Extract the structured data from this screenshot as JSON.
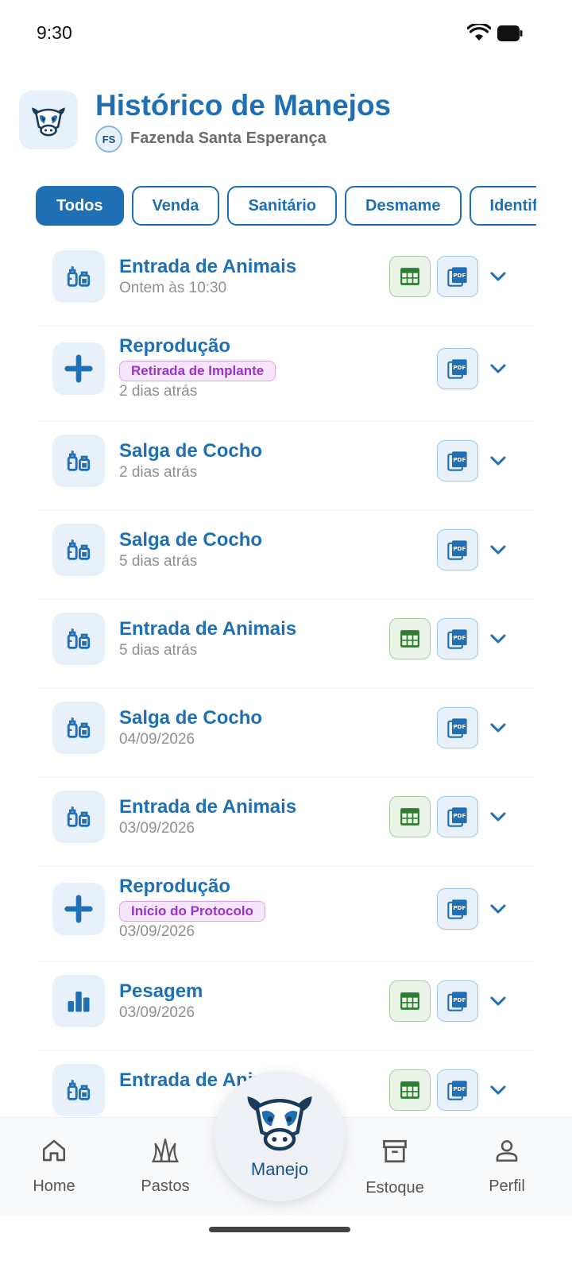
{
  "status_bar": {
    "time": "9:30"
  },
  "header": {
    "title": "Histórico de Manejos",
    "farm_initials": "FS",
    "farm_name": "Fazenda Santa Esperança"
  },
  "filters": [
    "Todos",
    "Venda",
    "Sanitário",
    "Desmame",
    "Identificação"
  ],
  "active_filter": "Todos",
  "records": [
    {
      "title": "Entrada de Animais",
      "tag": "",
      "date": "Ontem às 10:30",
      "icon": "vaccine-icon",
      "has_table": true
    },
    {
      "title": "Reprodução",
      "tag": "Retirada de Implante",
      "date": "2 dias atrás",
      "icon": "plus-icon",
      "has_table": false
    },
    {
      "title": "Salga de Cocho",
      "tag": "",
      "date": "2 dias atrás",
      "icon": "vaccine-icon",
      "has_table": false
    },
    {
      "title": "Salga de Cocho",
      "tag": "",
      "date": "5 dias atrás",
      "icon": "vaccine-icon",
      "has_table": false
    },
    {
      "title": "Entrada de Animais",
      "tag": "",
      "date": "5 dias atrás",
      "icon": "vaccine-icon",
      "has_table": true
    },
    {
      "title": "Salga de Cocho",
      "tag": "",
      "date": "04/09/2026",
      "icon": "vaccine-icon",
      "has_table": false
    },
    {
      "title": "Entrada de Animais",
      "tag": "",
      "date": "03/09/2026",
      "icon": "vaccine-icon",
      "has_table": true
    },
    {
      "title": "Reprodução",
      "tag": "Início do Protocolo",
      "date": "03/09/2026",
      "icon": "plus-icon",
      "has_table": false
    },
    {
      "title": "Pesagem",
      "tag": "",
      "date": "03/09/2026",
      "icon": "bar-chart-icon",
      "has_table": true
    },
    {
      "title": "Entrada de Animais",
      "tag": "",
      "date": "",
      "icon": "vaccine-icon",
      "has_table": true
    }
  ],
  "bottom_nav": {
    "home": "Home",
    "pastos": "Pastos",
    "manejo": "Manejo",
    "estoque": "Estoque",
    "perfil": "Perfil"
  },
  "colors": {
    "primary": "#1f6fb5",
    "tag_text": "#9c32c7",
    "table_icon": "#2e7d32",
    "muted": "#8f8f8f"
  }
}
